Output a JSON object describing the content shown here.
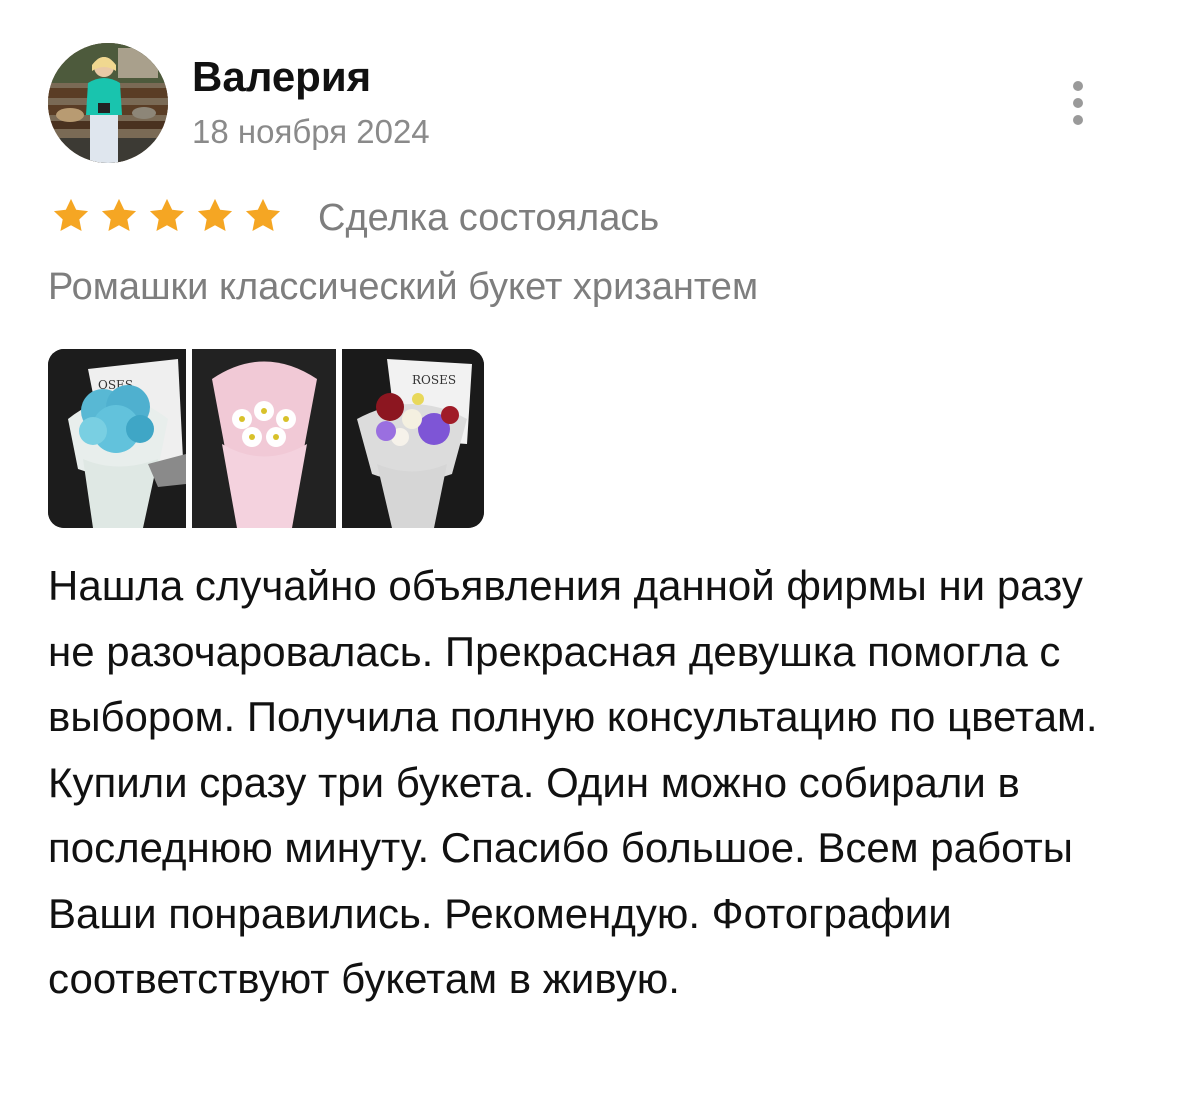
{
  "review": {
    "author": {
      "name": "Валерия",
      "avatar_icon": "user-avatar-photo"
    },
    "date": "18 ноября 2024",
    "menu_icon": "more-vertical-icon",
    "rating": 5,
    "rating_max": 5,
    "star_color": "#f5a623",
    "deal_status": "Сделка состоялась",
    "product_title": "Ромашки классический букет хризантем",
    "photos": [
      {
        "icon": "bouquet-photo-blue"
      },
      {
        "icon": "bouquet-photo-white-daisies"
      },
      {
        "icon": "bouquet-photo-mixed"
      }
    ],
    "text": "Нашла случайно объявления данной фирмы ни разу не разочаровалась. Прекрасная девушка помогла с выбором. Получила полную консультацию по цветам. Купили сразу три букета. Один можно собирали в последнюю минуту. Спасибо большое. Всем работы Ваши понравились. Рекомендую. Фотографии соответствуют букетам в живую."
  }
}
